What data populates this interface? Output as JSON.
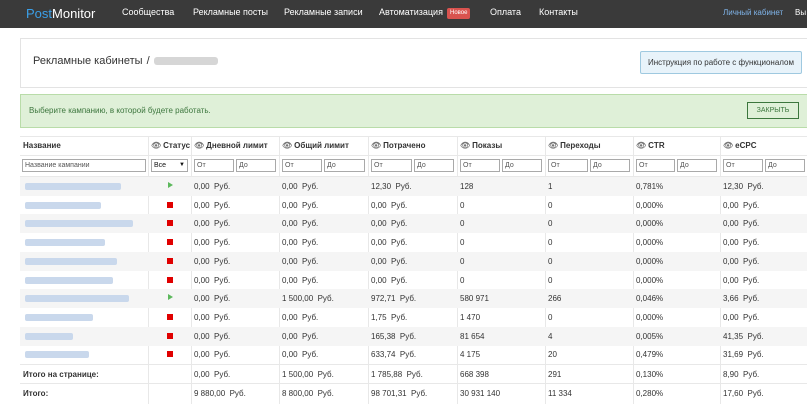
{
  "header": {
    "logo_a": "Post",
    "logo_b": "Monitor",
    "nav": [
      "Сообщества",
      "Рекламные посты",
      "Рекламные записи",
      "Автоматизация",
      "Оплата",
      "Контакты"
    ],
    "new_badge": "Новое",
    "account_label": "Личный кабинет",
    "account_extra": "Вы"
  },
  "page": {
    "title": "Рекламные кабинеты",
    "separator": "/",
    "guide_button": "Инструкция по работе с функционалом"
  },
  "alert": {
    "text": "Выберите кампанию, в которой будете работать.",
    "close_label": "ЗАКРЫТЬ"
  },
  "table": {
    "headers": [
      "Название",
      "Статус",
      "Дневной лимит",
      "Общий лимит",
      "Потрачено",
      "Показы",
      "Переходы",
      "CTR",
      "eCPC"
    ],
    "filter_name_placeholder": "Название кампании",
    "filter_status_value": "Все",
    "filter_from": "От",
    "filter_to": "До",
    "rows": [
      {
        "status": "active",
        "daily": "0,00",
        "total": "0,00",
        "spent": "12,30",
        "shows": "128",
        "clicks": "1",
        "ctr": "0,781%",
        "ecpc": "12,30"
      },
      {
        "status": "stopped",
        "daily": "0,00",
        "total": "0,00",
        "spent": "0,00",
        "shows": "0",
        "clicks": "0",
        "ctr": "0,000%",
        "ecpc": "0,00"
      },
      {
        "status": "stopped",
        "daily": "0,00",
        "total": "0,00",
        "spent": "0,00",
        "shows": "0",
        "clicks": "0",
        "ctr": "0,000%",
        "ecpc": "0,00"
      },
      {
        "status": "stopped",
        "daily": "0,00",
        "total": "0,00",
        "spent": "0,00",
        "shows": "0",
        "clicks": "0",
        "ctr": "0,000%",
        "ecpc": "0,00"
      },
      {
        "status": "stopped",
        "daily": "0,00",
        "total": "0,00",
        "spent": "0,00",
        "shows": "0",
        "clicks": "0",
        "ctr": "0,000%",
        "ecpc": "0,00"
      },
      {
        "status": "stopped",
        "daily": "0,00",
        "total": "0,00",
        "spent": "0,00",
        "shows": "0",
        "clicks": "0",
        "ctr": "0,000%",
        "ecpc": "0,00"
      },
      {
        "status": "active",
        "daily": "0,00",
        "total": "1 500,00",
        "spent": "972,71",
        "shows": "580 971",
        "clicks": "266",
        "ctr": "0,046%",
        "ecpc": "3,66"
      },
      {
        "status": "stopped",
        "daily": "0,00",
        "total": "0,00",
        "spent": "1,75",
        "shows": "1 470",
        "clicks": "0",
        "ctr": "0,000%",
        "ecpc": "0,00"
      },
      {
        "status": "stopped",
        "daily": "0,00",
        "total": "0,00",
        "spent": "165,38",
        "shows": "81 654",
        "clicks": "4",
        "ctr": "0,005%",
        "ecpc": "41,35"
      },
      {
        "status": "stopped",
        "daily": "0,00",
        "total": "0,00",
        "spent": "633,74",
        "shows": "4 175",
        "clicks": "20",
        "ctr": "0,479%",
        "ecpc": "31,69"
      }
    ],
    "currency": "Руб.",
    "page_total": {
      "label": "Итого на странице:",
      "daily": "0,00",
      "total": "1 500,00",
      "spent": "1 785,88",
      "shows": "668 398",
      "clicks": "291",
      "ctr": "0,130%",
      "ecpc": "8,90"
    },
    "grand_total": {
      "label": "Итого:",
      "daily": "9 880,00",
      "total": "8 800,00",
      "spent": "98 701,31",
      "shows": "30 931 140",
      "clicks": "11 334",
      "ctr": "0,280%",
      "ecpc": "17,60"
    }
  },
  "colors": {
    "topbar": "#3a3a3a",
    "logo_accent": "#3aa0ea",
    "new_badge": "#d9534f",
    "active_status": "#5cb85c",
    "stopped_status": "#e00000",
    "alert_bg": "#dff0d8"
  }
}
